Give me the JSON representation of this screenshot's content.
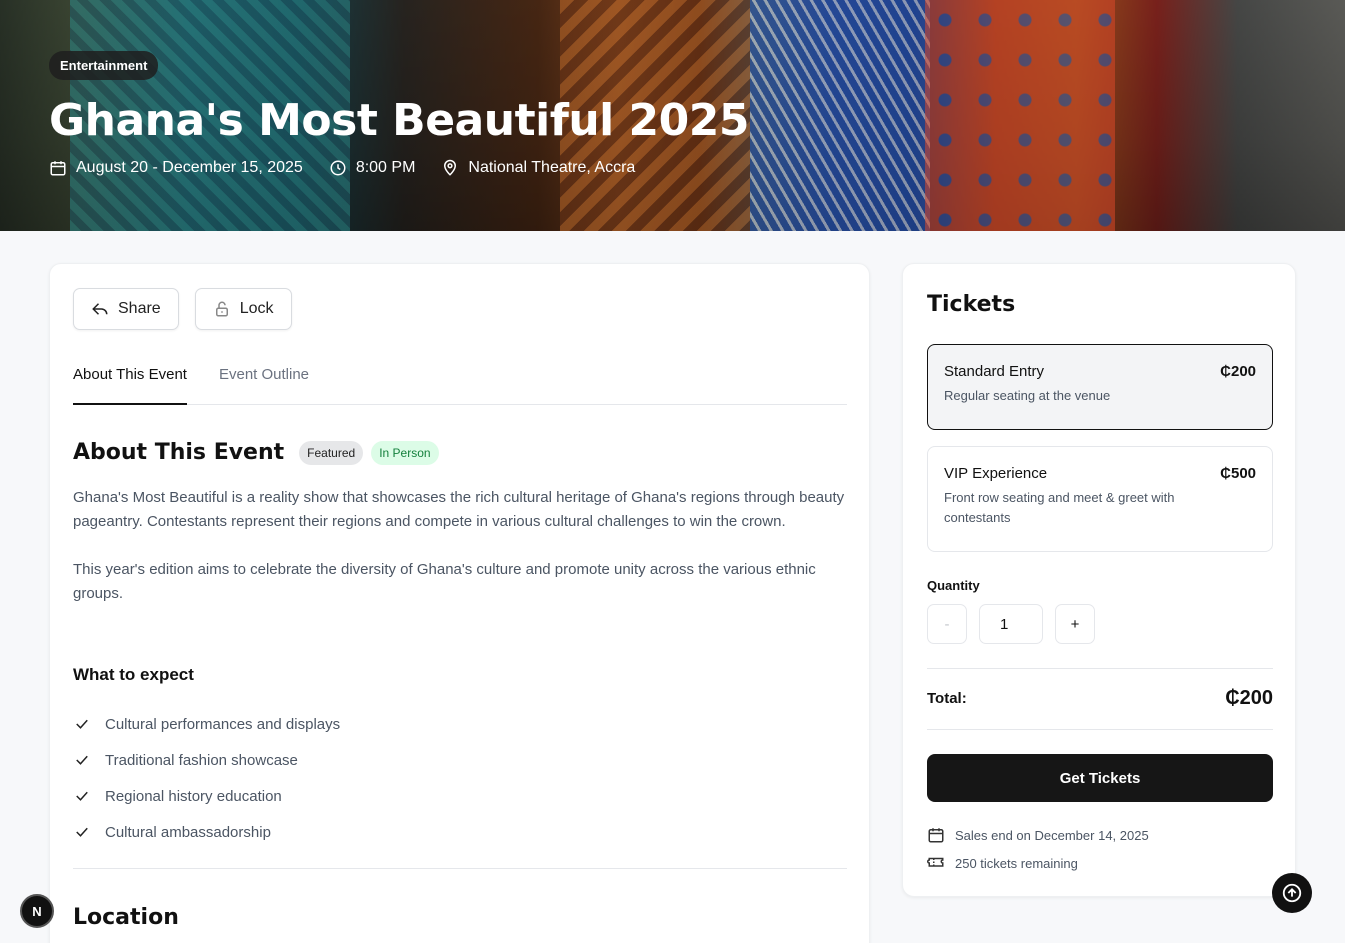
{
  "hero": {
    "category": "Entertainment",
    "title": "Ghana's Most Beautiful 2025",
    "date": "August 20 - December 15, 2025",
    "time": "8:00 PM",
    "venue": "National Theatre, Accra"
  },
  "actions": {
    "share_label": "Share",
    "lock_label": "Lock"
  },
  "tabs": [
    {
      "label": "About This Event"
    },
    {
      "label": "Event Outline"
    }
  ],
  "about": {
    "heading": "About This Event",
    "badges": [
      "Featured",
      "In Person"
    ],
    "paragraphs": [
      "Ghana's Most Beautiful is a reality show that showcases the rich cultural heritage of Ghana's regions through beauty pageantry. Contestants represent their regions and compete in various cultural challenges to win the crown.",
      "This year's edition aims to celebrate the diversity of Ghana's culture and promote unity across the various ethnic groups."
    ],
    "expect_title": "What to expect",
    "expect_items": [
      "Cultural performances and displays",
      "Traditional fashion showcase",
      "Regional history education",
      "Cultural ambassadorship"
    ],
    "location_title": "Location"
  },
  "tickets": {
    "title": "Tickets",
    "options": [
      {
        "name": "Standard Entry",
        "price": "₵200",
        "description": "Regular seating at the venue"
      },
      {
        "name": "VIP Experience",
        "price": "₵500",
        "description": "Front row seating and meet & greet with contestants"
      }
    ],
    "quantity_label": "Quantity",
    "quantity_minus": "-",
    "quantity_value": "1",
    "quantity_plus": "+",
    "total_label": "Total:",
    "total_value": "₵200",
    "cta_label": "Get Tickets",
    "sales_end": "Sales end on December 14, 2025",
    "remaining": "250 tickets remaining"
  },
  "floating": {
    "next_badge": "N"
  },
  "colors": {
    "primary": "#161616",
    "featured_bg": "#e6e7e9",
    "in_person_bg": "#dcfce7",
    "in_person_text": "#15803d"
  }
}
